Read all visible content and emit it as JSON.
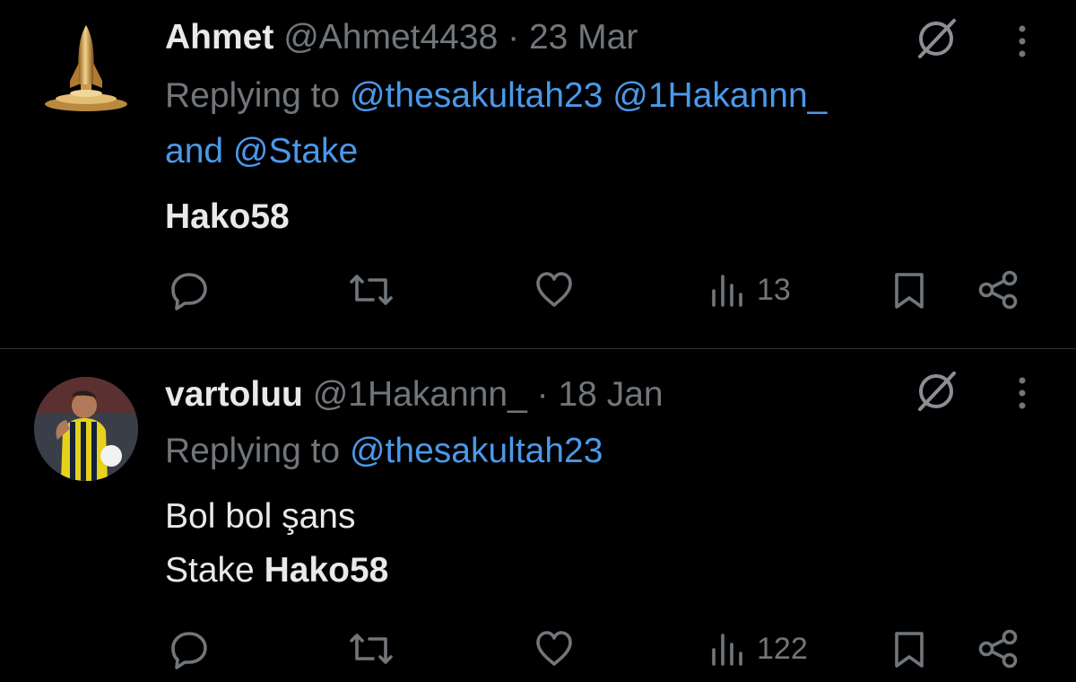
{
  "tweets": [
    {
      "name": "Ahmet",
      "handle": "@Ahmet4438",
      "separator": "·",
      "date": "23 Mar",
      "replying_prefix": "Replying to",
      "mention_1": "@thesakultah23",
      "mention_2": "@1Hakannn_",
      "mention_joiner": "and",
      "mention_3": "@Stake",
      "text_bold": "Hako58",
      "views": "13",
      "avatar": "rocket-avatar"
    },
    {
      "name": "vartoluu",
      "handle": "@1Hakannn_",
      "separator": "·",
      "date": "18 Jan",
      "replying_prefix": "Replying to",
      "mention_1": "@thesakultah23",
      "line1": "Bol bol şans",
      "line2_plain": "Stake",
      "line2_bold": "Hako58",
      "views": "122",
      "avatar": "football-player-avatar"
    }
  ],
  "icons": {
    "reply": "reply-icon",
    "retweet": "retweet-icon",
    "like": "like-icon",
    "views": "views-icon",
    "bookmark": "bookmark-icon",
    "share": "share-icon",
    "grok": "grok-icon",
    "more": "more-icon"
  },
  "colors": {
    "background": "#000000",
    "text": "#e7e9ea",
    "secondary": "#71767b",
    "mention": "#4a99e9",
    "divider": "#2f3336"
  }
}
